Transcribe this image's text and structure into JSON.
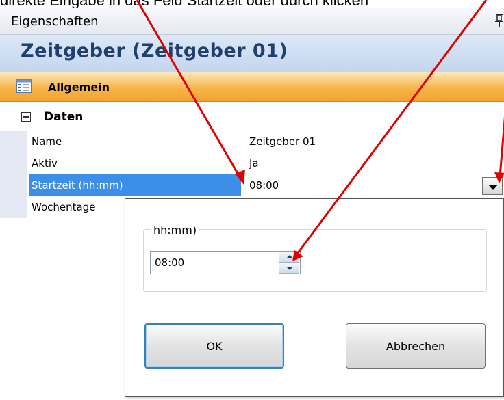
{
  "caption": {
    "text": "direkte Eingabe in das Feld Startzeit oder durch klicken"
  },
  "panel": {
    "title": "Eigenschaften",
    "pin_icon": "pin-icon"
  },
  "object_title": "Zeitgeber (Zeitgeber 01)",
  "category": {
    "label": "Allgemein",
    "icon": "property-pages-icon"
  },
  "group": {
    "label": "Daten",
    "expanded": true
  },
  "properties": [
    {
      "name": "Name",
      "value": "Zeitgeber 01"
    },
    {
      "name": "Aktiv",
      "value": "Ja"
    },
    {
      "name": "Startzeit (hh:mm)",
      "value": "08:00",
      "selected": true
    },
    {
      "name": "Wochentage",
      "value": ""
    }
  ],
  "popup": {
    "group_label": "hh:mm)",
    "time_value": "08:00",
    "ok_label": "OK",
    "cancel_label": "Abbrechen"
  },
  "colors": {
    "selection": "#3d8ee6",
    "category_bar": "#f7b54a",
    "title_text": "#1f3f6e",
    "annotation_arrow": "#e00000"
  }
}
